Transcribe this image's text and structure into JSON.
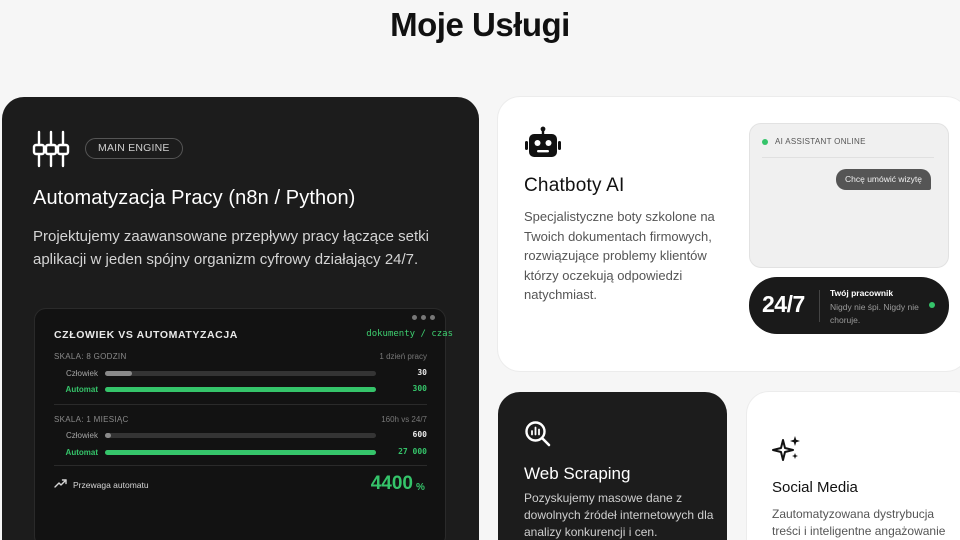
{
  "page": {
    "title": "Moje Usługi"
  },
  "automation": {
    "badge": "MAIN ENGINE",
    "title": "Automatyzacja Pracy (n8n / Python)",
    "description": "Projektujemy zaawansowane przepływy pracy łączące setki aplikacji w jeden spójny organizm cyfrowy działający 24/7.",
    "icon": "sliders-icon",
    "comparison": {
      "title": "CZŁOWIEK VS AUTOMATYZACJA",
      "legend": "dokumenty / czas",
      "scales": [
        {
          "label": "SKALA: 8 GODZIN",
          "note": "1 dzień pracy",
          "rows": [
            {
              "label": "Człowiek",
              "value": "30",
              "fraction": 0.1
            },
            {
              "label": "Automat",
              "value": "300",
              "fraction": 1.0
            }
          ]
        },
        {
          "label": "SKALA: 1 MIESIĄC",
          "note": "160h vs 24/7",
          "rows": [
            {
              "label": "Człowiek",
              "value": "600",
              "fraction": 0.022
            },
            {
              "label": "Automat",
              "value": "27 000",
              "fraction": 1.0
            }
          ]
        }
      ],
      "advantage_label": "Przewaga automatu",
      "advantage_value": "4400",
      "advantage_unit": "%"
    }
  },
  "chatbots": {
    "icon": "robot-icon",
    "title": "Chatboty AI",
    "description": "Specjalistyczne boty szkolone na Twoich dokumentach firmowych, rozwiązujące problemy klientów którzy oczekują odpowiedzi natychmiast.",
    "status": "AI ASSISTANT ONLINE",
    "message": "Chcę umówić wizytę",
    "worker_big": "24/7",
    "worker_title": "Twój pracownik",
    "worker_sub": "Nigdy nie śpi. Nigdy nie choruje."
  },
  "scraping": {
    "icon": "magnifier-chart-icon",
    "title": "Web Scraping",
    "description": "Pozyskujemy masowe dane z dowolnych źródeł internetowych dla analizy konkurencji i cen."
  },
  "social": {
    "icon": "sparkles-icon",
    "title": "Social Media",
    "description": "Zautomatyzowana dystrybucja treści i inteligentne angażowanie"
  },
  "colors": {
    "accent": "#35c46a",
    "dark": "#1c1c1c",
    "light": "#ffffff",
    "background": "#f6f6f6"
  }
}
